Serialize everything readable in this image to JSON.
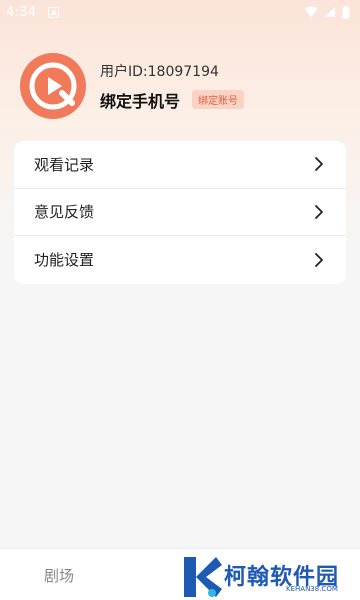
{
  "status_bar": {
    "time": "4:34"
  },
  "profile": {
    "user_id": "用户ID:18097194",
    "bind_phone": "绑定手机号",
    "bind_badge": "绑定账号"
  },
  "menu": {
    "items": [
      {
        "label": "观看记录"
      },
      {
        "label": "意见反馈"
      },
      {
        "label": "功能设置"
      }
    ]
  },
  "bottom_nav": {
    "theater_label": "剧场"
  },
  "watermark": {
    "text": "柯翰软件园",
    "url": "KEHAN38.COM"
  },
  "colors": {
    "accent": "#f07a5a",
    "badge_bg": "#fbd3c6",
    "badge_text": "#e0603c",
    "watermark": "#1e5ab4"
  }
}
